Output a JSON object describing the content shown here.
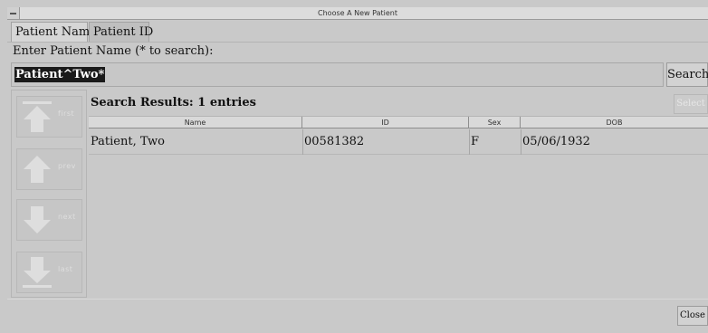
{
  "window": {
    "title": "Choose A New Patient"
  },
  "tabs": [
    {
      "label": "Patient Name",
      "active": true
    },
    {
      "label": "Patient ID",
      "active": false
    }
  ],
  "search": {
    "label": "Enter Patient Name (* to search):",
    "value": "Patient^Two*",
    "button_label": "Search"
  },
  "navigation": {
    "first_label": "first",
    "prev_label": "prev",
    "next_label": "next",
    "last_label": "last"
  },
  "results": {
    "title": "Search Results: 1 entries",
    "select_label": "Select",
    "columns": [
      "Name",
      "ID",
      "Sex",
      "DOB"
    ],
    "rows": [
      {
        "name": "Patient, Two",
        "id": "00581382",
        "sex": "F",
        "dob": "05/06/1932"
      }
    ]
  },
  "footer": {
    "close_label": "Close"
  },
  "colors": {
    "background": "#c9c9c9",
    "selection": "#1a1a1a"
  }
}
